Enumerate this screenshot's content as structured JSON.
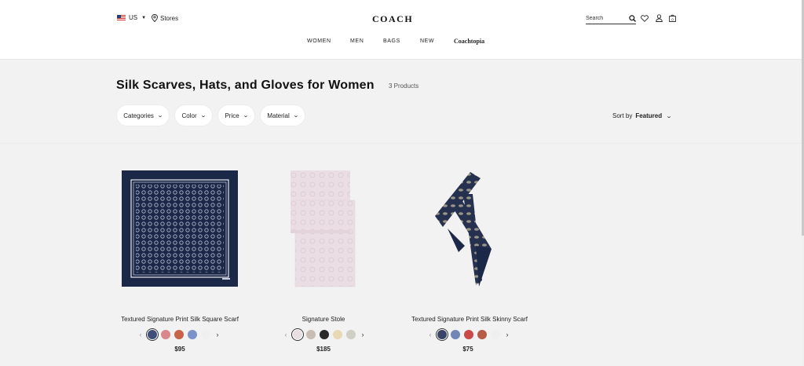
{
  "header": {
    "locale_label": "US",
    "stores_label": "Stores",
    "logo_text": "COACH",
    "search_placeholder": "Search"
  },
  "nav": {
    "items": [
      "WOMEN",
      "MEN",
      "BAGS",
      "NEW"
    ],
    "brand_item": "Coachtopia"
  },
  "page": {
    "title": "Silk Scarves, Hats, and Gloves for Women",
    "product_count": "3 Products"
  },
  "filters": [
    "Categories",
    "Color",
    "Price",
    "Material"
  ],
  "sort": {
    "label": "Sort by",
    "value": "Featured"
  },
  "products": [
    {
      "name": "Textured Signature Print Silk Square Scarf",
      "price": "$95",
      "swatches": [
        "#3e4f7a",
        "#d9878a",
        "#c8634a",
        "#7a93c9",
        "#efefef"
      ]
    },
    {
      "name": "Signature Stole",
      "price": "$185",
      "swatches": [
        "#e9dfe3",
        "#c9bcb2",
        "#2a2a2a",
        "#e8d8b6",
        "#cfcfc4"
      ]
    },
    {
      "name": "Textured Signature Print Silk Skinny Scarf",
      "price": "$75",
      "swatches": [
        "#3a4468",
        "#6f86b6",
        "#c94848",
        "#b85c4a",
        "#efefef"
      ]
    }
  ],
  "colors": {
    "navy": "#1c2848",
    "stole_pink": "#eadde3"
  }
}
